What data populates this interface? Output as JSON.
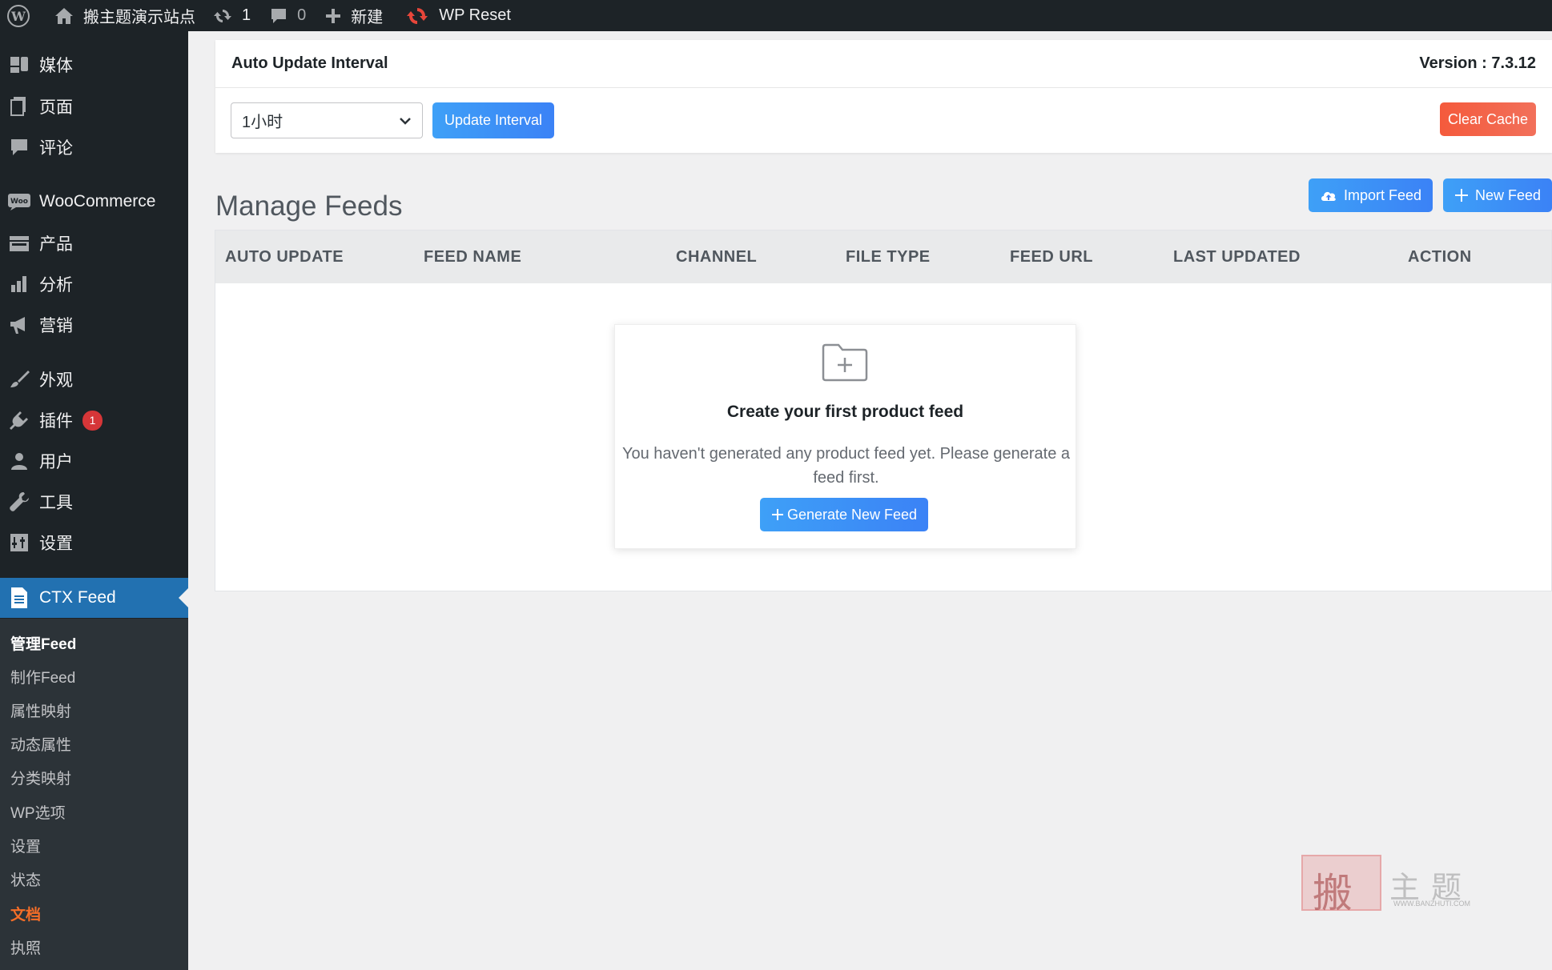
{
  "adminbar": {
    "site_name": "搬主题演示站点",
    "updates_count": "1",
    "comments_count": "0",
    "new_label": "新建",
    "wp_reset_label": "WP Reset"
  },
  "sidebar": {
    "items": [
      {
        "label": "媒体",
        "icon": "media-icon"
      },
      {
        "label": "页面",
        "icon": "page-icon"
      },
      {
        "label": "评论",
        "icon": "comment-icon"
      },
      {
        "label": "WooCommerce",
        "icon": "woo-icon"
      },
      {
        "label": "产品",
        "icon": "product-icon"
      },
      {
        "label": "分析",
        "icon": "analytics-icon"
      },
      {
        "label": "营销",
        "icon": "megaphone-icon"
      },
      {
        "label": "外观",
        "icon": "brush-icon"
      },
      {
        "label": "插件",
        "icon": "plugin-icon",
        "badge": "1"
      },
      {
        "label": "用户",
        "icon": "user-icon"
      },
      {
        "label": "工具",
        "icon": "wrench-icon"
      },
      {
        "label": "设置",
        "icon": "settings-icon"
      },
      {
        "label": "CTX Feed",
        "icon": "document-icon"
      }
    ],
    "submenu": [
      "管理Feed",
      "制作Feed",
      "属性映射",
      "动态属性",
      "分类映射",
      "WP选项",
      "设置",
      "状态",
      "文档",
      "执照"
    ]
  },
  "auto_update": {
    "title": "Auto Update Interval",
    "version": "Version : 7.3.12",
    "selected_interval": "1小时",
    "update_button": "Update Interval",
    "clear_cache_button": "Clear Cache"
  },
  "manage": {
    "title": "Manage Feeds",
    "import_button": "Import Feed",
    "new_button": "New Feed",
    "columns": [
      "AUTO UPDATE",
      "FEED NAME",
      "CHANNEL",
      "FILE TYPE",
      "FEED URL",
      "LAST UPDATED",
      "ACTION"
    ],
    "empty": {
      "title": "Create your first product feed",
      "description": "You haven't generated any product feed yet. Please generate a feed first.",
      "button": "Generate New Feed"
    }
  },
  "watermark": {
    "char": "搬",
    "text": "主题",
    "url": "WWW.BANZHUTI.COM"
  },
  "colors": {
    "sidebar_bg": "#1d2327",
    "active": "#2271b1",
    "blue_button": "#3b82f6",
    "clear_cache": "#f45a3c",
    "badge": "#d63638"
  }
}
